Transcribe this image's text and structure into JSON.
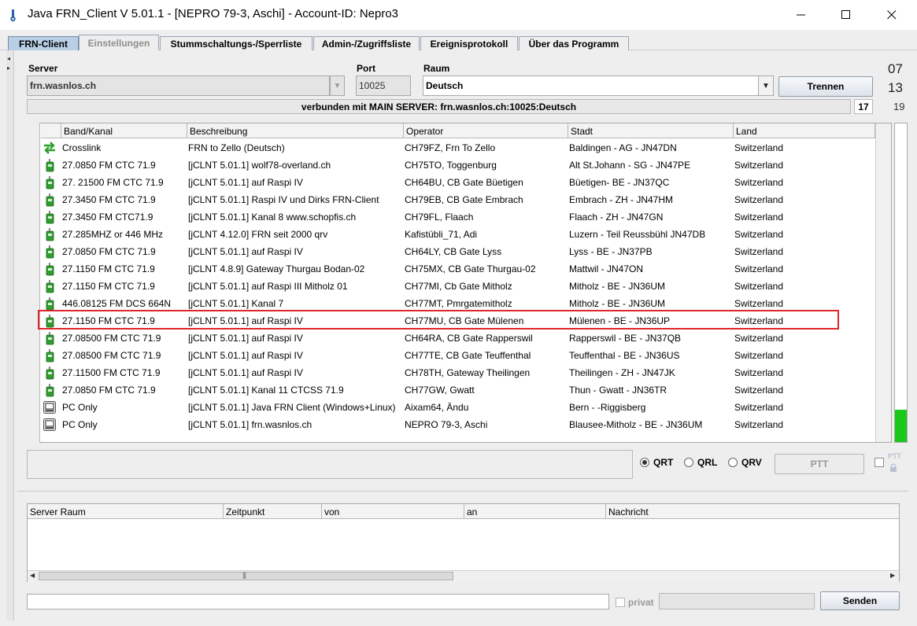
{
  "window": {
    "title": "Java FRN_Client V 5.01.1 - [NEPRO 79-3, Aschi] - Account-ID: Nepro3",
    "controls": {
      "minimize": "—",
      "maximize": "☐",
      "close": "✕"
    }
  },
  "tabs": [
    {
      "label": "FRN-Client",
      "state": "active"
    },
    {
      "label": "Einstellungen",
      "state": "disabled"
    },
    {
      "label": "Stummschaltungs-/Sperrliste",
      "state": "normal"
    },
    {
      "label": "Admin-/Zugriffsliste",
      "state": "normal"
    },
    {
      "label": "Ereignisprotokoll",
      "state": "normal"
    },
    {
      "label": "Über das Programm",
      "state": "normal"
    }
  ],
  "connection": {
    "server_label": "Server",
    "server_value": "frn.wasnlos.ch",
    "port_label": "Port",
    "port_value": "10025",
    "room_label": "Raum",
    "room_value": "Deutsch",
    "disconnect_button": "Trennen",
    "status_text": "verbunden mit  MAIN SERVER: frn.wasnlos.ch:10025:Deutsch",
    "status_count": "17",
    "counter_top": "07",
    "counter_mid": "13",
    "counter_bottom": "19"
  },
  "user_table": {
    "headers": [
      "Band/Kanal",
      "Beschreibung",
      "Operator",
      "Stadt",
      "Land"
    ],
    "rows": [
      {
        "icon": "crosslink-icon",
        "band": "Crosslink",
        "desc": "FRN to Zello (Deutsch)",
        "operator": "CH79FZ, Frn To Zello",
        "city": "Baldingen - AG - JN47DN",
        "country": "Switzerland"
      },
      {
        "icon": "radio-icon",
        "band": "27.0850 FM CTC 71.9",
        "desc": "[jCLNT 5.01.1] wolf78-overland.ch",
        "operator": "CH75TO, Toggenburg",
        "city": "Alt St.Johann - SG - JN47PE",
        "country": "Switzerland"
      },
      {
        "icon": "radio-icon",
        "band": "27. 21500 FM CTC 71.9",
        "desc": "[jCLNT 5.01.1] auf Raspi IV",
        "operator": "CH64BU, CB Gate Büetigen",
        "city": "Büetigen- BE - JN37QC",
        "country": "Switzerland"
      },
      {
        "icon": "radio-icon",
        "band": "27.3450 FM CTC 71.9",
        "desc": "[jCLNT 5.01.1] Raspi IV und Dirks FRN-Client",
        "operator": "CH79EB, CB Gate Embrach",
        "city": "Embrach - ZH - JN47HM",
        "country": "Switzerland"
      },
      {
        "icon": "radio-icon",
        "band": "27.3450 FM CTC71.9",
        "desc": "[jCLNT 5.01.1] Kanal 8  www.schopfis.ch",
        "operator": "CH79FL, Flaach",
        "city": "Flaach - ZH - JN47GN",
        "country": "Switzerland"
      },
      {
        "icon": "radio-icon",
        "band": "27.285MHZ or 446 MHz",
        "desc": "[jCLNT 4.12.0] FRN seit 2000 qrv",
        "operator": "Kafistübli_71, Adi",
        "city": "Luzern - Teil Reussbühl JN47DB",
        "country": "Switzerland"
      },
      {
        "icon": "radio-icon",
        "band": "27.0850 FM CTC 71.9",
        "desc": "[jCLNT 5.01.1] auf Raspi IV",
        "operator": "CH64LY, CB Gate Lyss",
        "city": "Lyss - BE - JN37PB",
        "country": "Switzerland"
      },
      {
        "icon": "radio-icon",
        "band": "27.1150 FM CTC 71.9",
        "desc": "[jCLNT 4.8.9] Gateway Thurgau Bodan-02",
        "operator": "CH75MX, CB Gate Thurgau-02",
        "city": "Mattwil - JN47ON",
        "country": "Switzerland"
      },
      {
        "icon": "radio-icon",
        "band": "27.1150 FM CTC 71.9",
        "desc": "[jCLNT 5.01.1] auf Raspi III  Mitholz 01",
        "operator": "CH77MI, Cb Gate Mitholz",
        "city": "Mitholz - BE - JN36UM",
        "country": "Switzerland"
      },
      {
        "icon": "radio-icon",
        "band": "446.08125 FM DCS 664N",
        "desc": "[jCLNT 5.01.1] Kanal 7",
        "operator": "CH77MT, Pmrgatemitholz",
        "city": "Mitholz - BE - JN36UM",
        "country": "Switzerland"
      },
      {
        "icon": "radio-icon",
        "band": "27.1150 FM CTC 71.9",
        "desc": "[jCLNT 5.01.1] auf Raspi IV",
        "operator": "CH77MU, CB Gate Mülenen",
        "city": "Mülenen - BE - JN36UP",
        "country": "Switzerland"
      },
      {
        "icon": "radio-icon",
        "band": "27.08500 FM CTC 71.9",
        "desc": "[jCLNT 5.01.1] auf Raspi IV",
        "operator": "CH64RA, CB Gate Rapperswil",
        "city": "Rapperswil - BE - JN37QB",
        "country": "Switzerland"
      },
      {
        "icon": "radio-icon",
        "band": "27.08500 FM CTC 71.9",
        "desc": "[jCLNT 5.01.1] auf Raspi IV",
        "operator": "CH77TE, CB Gate Teuffenthal",
        "city": "Teuffenthal - BE - JN36US",
        "country": "Switzerland"
      },
      {
        "icon": "radio-icon",
        "band": "27.11500 FM CTC 71.9",
        "desc": "[jCLNT 5.01.1] auf Raspi IV",
        "operator": "CH78TH, Gateway Theilingen",
        "city": "Theilingen - ZH - JN47JK",
        "country": "Switzerland"
      },
      {
        "icon": "radio-icon",
        "band": "27.0850 FM CTC 71.9",
        "desc": "[jCLNT 5.01.1] Kanal 11 CTCSS 71.9",
        "operator": "CH77GW, Gwatt",
        "city": "Thun - Gwatt - JN36TR",
        "country": "Switzerland"
      },
      {
        "icon": "pc-icon",
        "band": "PC Only",
        "desc": "[jCLNT 5.01.1] Java FRN Client (Windows+Linux)",
        "operator": "Aixam64, Ändu",
        "city": "Bern - -Riggisberg",
        "country": "Switzerland"
      },
      {
        "icon": "pc-icon",
        "band": "PC Only",
        "desc": "[jCLNT 5.01.1] frn.wasnlos.ch",
        "operator": "NEPRO 79-3, Aschi",
        "city": "Blausee-Mitholz - BE - JN36UM",
        "country": "Switzerland"
      }
    ]
  },
  "audio_level": 0.1,
  "ptt_panel": {
    "modes": [
      {
        "label": "QRT",
        "checked": true
      },
      {
        "label": "QRL",
        "checked": false
      },
      {
        "label": "QRV",
        "checked": false
      }
    ],
    "ptt_button": "PTT",
    "ptt_lock_label": "PTT"
  },
  "chat": {
    "headers": [
      "Server Raum",
      "Zeitpunkt",
      "von",
      "an",
      "Nachricht"
    ],
    "input_value": "",
    "privat_label": "privat",
    "send_button": "Senden"
  },
  "colors": {
    "active_tab": "#b8cfe5",
    "highlight": "#e0262b",
    "level": "#19c819",
    "radio_icon": "#2e9e2e"
  }
}
